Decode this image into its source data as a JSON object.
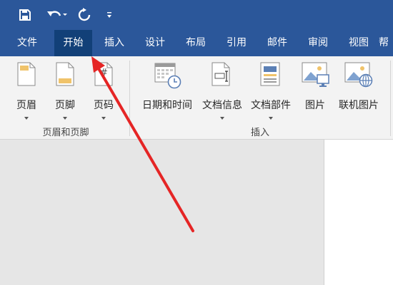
{
  "quick_access": {
    "save_icon": "save-icon",
    "undo_icon": "undo-icon",
    "redo_icon": "redo-icon",
    "customize_icon": "customize-icon"
  },
  "tabs": [
    {
      "label": "文件"
    },
    {
      "label": "开始",
      "active": true
    },
    {
      "label": "插入"
    },
    {
      "label": "设计"
    },
    {
      "label": "布局"
    },
    {
      "label": "引用"
    },
    {
      "label": "邮件"
    },
    {
      "label": "审阅"
    },
    {
      "label": "视图"
    },
    {
      "label": "帮"
    }
  ],
  "groups": {
    "header_footer": {
      "label": "页眉和页脚",
      "buttons": [
        {
          "label": "页眉",
          "icon": "header-icon"
        },
        {
          "label": "页脚",
          "icon": "footer-icon"
        },
        {
          "label": "页码",
          "icon": "page-number-icon",
          "glyph": "#"
        }
      ]
    },
    "insert": {
      "label": "插入",
      "buttons": [
        {
          "label": "日期和时间",
          "icon": "calendar-clock-icon"
        },
        {
          "label": "文档信息",
          "icon": "document-info-icon"
        },
        {
          "label": "文档部件",
          "icon": "document-parts-icon"
        },
        {
          "label": "图片",
          "icon": "picture-icon"
        },
        {
          "label": "联机图片",
          "icon": "online-picture-icon"
        }
      ]
    }
  },
  "colors": {
    "title_bar": "#2b579a",
    "active_tab": "#124078",
    "ribbon": "#f3f3f3",
    "annotation_arrow": "#e52525"
  }
}
